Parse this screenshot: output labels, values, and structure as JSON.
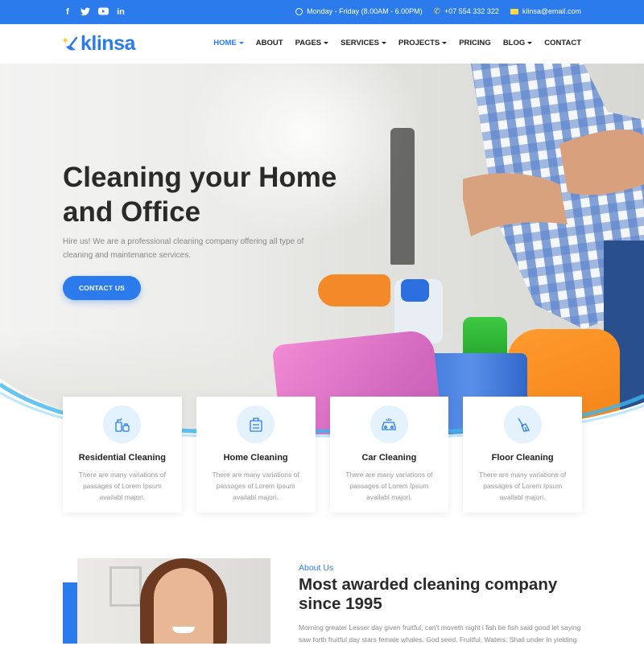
{
  "topbar": {
    "social": [
      "f",
      "t",
      "▶",
      "in"
    ],
    "hours": "Monday - Friday (8.00AM - 6.00PM)",
    "phone": "+07 554 332 322",
    "email": "klinsa@email.com"
  },
  "brand": {
    "name": "klinsa",
    "color": "#2b7bec"
  },
  "nav": {
    "items": [
      {
        "label": "HOME",
        "dropdown": true,
        "active": true
      },
      {
        "label": "ABOUT",
        "dropdown": false
      },
      {
        "label": "PAGES",
        "dropdown": true
      },
      {
        "label": "SERVICES",
        "dropdown": true
      },
      {
        "label": "PROJECTS",
        "dropdown": true
      },
      {
        "label": "PRICING",
        "dropdown": false
      },
      {
        "label": "BLOG",
        "dropdown": true
      },
      {
        "label": "CONTACT",
        "dropdown": false
      }
    ]
  },
  "hero": {
    "title": "Cleaning your Home and Office",
    "subtitle": "Hire us! We are a professional cleaning company offering all type of cleaning and maintenance services.",
    "cta": "CONTACT US"
  },
  "services": [
    {
      "icon": "cleaning-supplies-icon",
      "title": "Residential Cleaning",
      "text": "There are many variations of passages of Lorem Ipsum availabl majori."
    },
    {
      "icon": "home-cleaning-icon",
      "title": "Home Cleaning",
      "text": "There are many variations of passages of Lorem Ipsum availabl majori."
    },
    {
      "icon": "car-icon",
      "title": "Car Cleaning",
      "text": "There are many variations of passages of Lorem Ipsum availabl majori."
    },
    {
      "icon": "broom-icon",
      "title": "Floor Cleaning",
      "text": "There are many variations of passages of Lorem Ipsum availabl majori."
    }
  ],
  "about": {
    "label": "About Us",
    "title": "Most awarded cleaning company since 1995",
    "text": "Morning greater Lesser day given fruitful, can't moveth night i fish be fish said good let saying saw forth fruitful day stars female whales. God seed. Fruitful. Waters. Shall under In yielding"
  },
  "colors": {
    "primary": "#2b7bec",
    "iconBg": "#e4f2fd",
    "accentYellow": "#ffd84a"
  }
}
